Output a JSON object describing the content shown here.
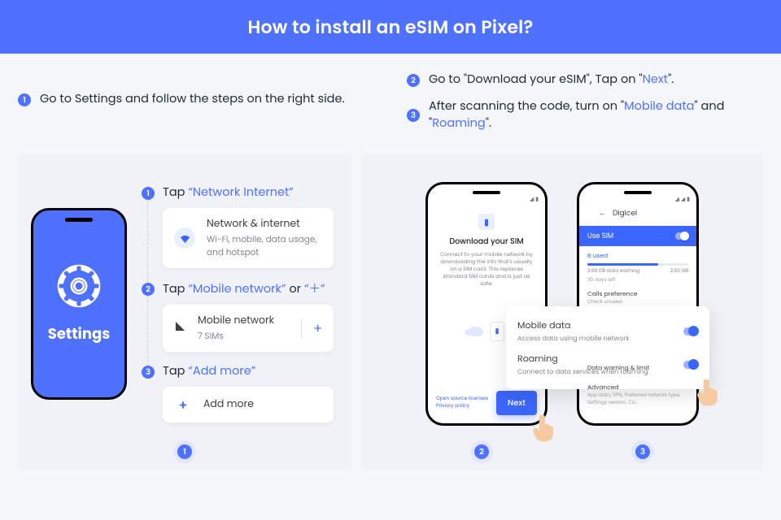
{
  "header": {
    "title": "How to install an eSIM on Pixel?"
  },
  "intro": {
    "left": {
      "n": "1",
      "text": "Go to Settings and follow the steps on the right side."
    },
    "right2": {
      "n": "2",
      "pre": "Go to \"Download your eSIM\", Tap on \"",
      "hl": "Next",
      "post": "\"."
    },
    "right3": {
      "n": "3",
      "pre": "After scanning the code, turn on \"",
      "hl1": "Mobile data",
      "mid": "\" and \"",
      "hl2": "Roaming",
      "post": "\"."
    }
  },
  "panelA": {
    "phone_label": "Settings",
    "s1": {
      "n": "1",
      "tap": "Tap ",
      "hl": "“Network Internet”",
      "card_title": "Network & internet",
      "card_sub": "Wi-Fi, mobile, data usage, and hotspot"
    },
    "s2": {
      "n": "2",
      "tap": "Tap ",
      "hl": "“Mobile network”",
      "or": " or ",
      "hl2": "“＋”",
      "card_title": "Mobile network",
      "card_sub": "7 SIMs"
    },
    "s3": {
      "n": "3",
      "tap": "Tap ",
      "hl": "“Add more”",
      "card_title": "Add more"
    },
    "foot": "1"
  },
  "panelB": {
    "phone2": {
      "title": "Download your SIM",
      "desc": "Connect to your mobile network by downloading the info that's usually on a SIM card. This replaces standard SIM cards and is just as safe.",
      "links": "Open source licenses  Privacy policy",
      "next": "Next"
    },
    "phone3": {
      "carrier": "Digicel",
      "use_sim": "Use SIM",
      "usage_lbl": "B used",
      "usage_left": "2.00 GB data warning",
      "usage_right": "2.00 GB",
      "usage_days": "30 days left",
      "calls_pref": "Calls preference",
      "calls_sub": "Check unused",
      "lower1": "Data warning & limit",
      "lower2": "Advanced",
      "lower2_sub": "App data, VPN, Preferred network type, Settings version, Ca..."
    },
    "overlay": {
      "md_title": "Mobile data",
      "md_sub": "Access data using mobile network",
      "rm_title": "Roaming",
      "rm_sub": "Connect to data services when roaming"
    },
    "foot2": "2",
    "foot3": "3"
  }
}
